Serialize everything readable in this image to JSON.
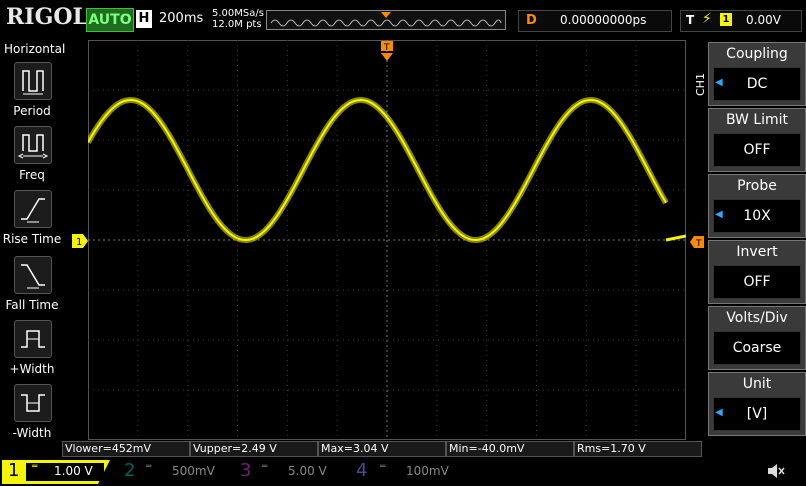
{
  "top": {
    "logo": "RIGOL",
    "status": "AUTO",
    "h_label": "H",
    "timebase": "200ms",
    "sample_rate": "5.00MSa/s",
    "points": "12.0M pts",
    "delay_label": "D",
    "delay_value": "0.00000000ps",
    "trigger_label": "T",
    "trigger_channel": "1",
    "trigger_level": "0.00V"
  },
  "left_menu": {
    "title": "Horizontal",
    "items": [
      {
        "label": "Period",
        "icon": "period-icon"
      },
      {
        "label": "Freq",
        "icon": "frequency-icon"
      },
      {
        "label": "Rise Time",
        "icon": "rise-time-icon"
      },
      {
        "label": "Fall Time",
        "icon": "fall-time-icon"
      },
      {
        "label": "+Width",
        "icon": "positive-width-icon"
      },
      {
        "label": "-Width",
        "icon": "negative-width-icon"
      }
    ]
  },
  "right_menu": {
    "channel_tag": "CH1",
    "items": [
      {
        "title": "Coupling",
        "value": "DC",
        "arrow": true
      },
      {
        "title": "BW Limit",
        "value": "OFF",
        "arrow": false
      },
      {
        "title": "Probe",
        "value": "10X",
        "arrow": true
      },
      {
        "title": "Invert",
        "value": "OFF",
        "arrow": false
      },
      {
        "title": "Volts/Div",
        "value": "Coarse",
        "arrow": false
      },
      {
        "title": "Unit",
        "value": "[V]",
        "arrow": true
      }
    ]
  },
  "measurements": [
    {
      "text": "Vlower=452mV"
    },
    {
      "text": "Vupper=2.49 V"
    },
    {
      "text": "Max=3.04 V"
    },
    {
      "text": "Min=-40.0mV"
    },
    {
      "text": "Rms=1.70 V"
    }
  ],
  "channels": [
    {
      "num": "1",
      "scale": "1.00 V",
      "color": "#f5f500"
    },
    {
      "num": "2",
      "scale": "500mV",
      "color": "#00d2d2"
    },
    {
      "num": "3",
      "scale": "5.00 V",
      "color": "#d040d0"
    },
    {
      "num": "4",
      "scale": "100mV",
      "color": "#4a7aff"
    }
  ],
  "markers": {
    "ch1_ground": "1",
    "trigger_marker": "T"
  },
  "colors": {
    "ch1": "#f5f500",
    "trigger": "#ff8a00",
    "accent_blue": "#2aa6ff"
  }
}
